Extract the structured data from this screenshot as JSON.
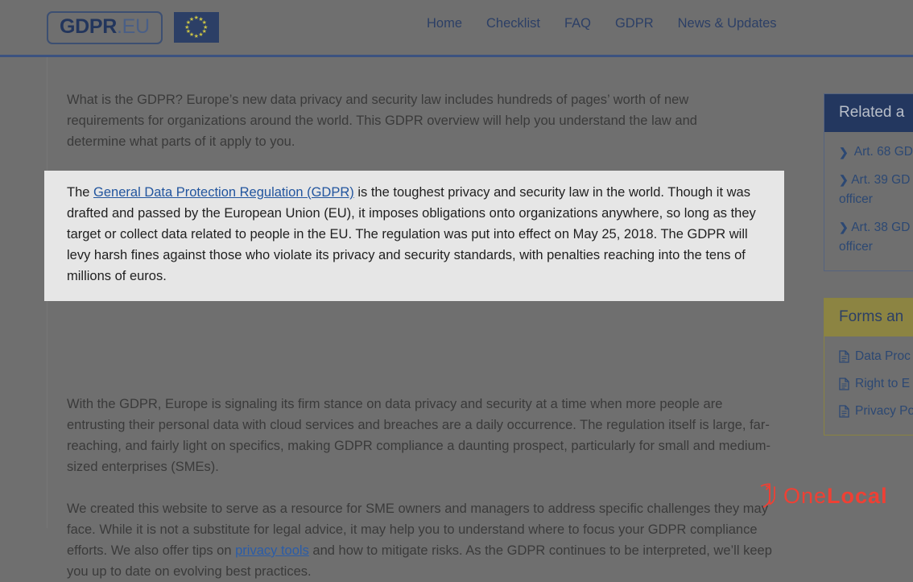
{
  "header": {
    "logo": {
      "primary": "GDPR",
      "secondary": ".EU"
    },
    "flag_alt": "eu-flag",
    "nav": [
      {
        "label": "Home"
      },
      {
        "label": "Checklist"
      },
      {
        "label": "FAQ"
      },
      {
        "label": "GDPR"
      },
      {
        "label": "News & Updates"
      }
    ]
  },
  "article": {
    "intro": "What is the GDPR? Europe’s new data privacy and security law includes hundreds of pages’ worth of new requirements for organizations around the world. This GDPR overview will help you understand the law and determine what parts of it apply to you.",
    "highlight": {
      "lead": "The ",
      "link": "General Data Protection Regulation (GDPR)",
      "rest": " is the toughest privacy and security law in the world. Though it was drafted and passed by the European Union (EU), it imposes obligations onto organizations anywhere, so long as they target or collect data related to people in the EU. The regulation was put into effect on May 25, 2018. The GDPR will levy harsh fines against those who violate its privacy and security standards, with penalties reaching into the tens of millions of euros."
    },
    "para2": "With the GDPR, Europe is signaling its firm stance on data privacy and security at a time when more people are entrusting their personal data with cloud services and breaches are a daily occurrence. The regulation itself is large, far-reaching, and fairly light on specifics, making GDPR compliance a daunting prospect, particularly for small and medium-sized enterprises (SMEs).",
    "para3": {
      "before": "We created this website to serve as a resource for SME owners and managers to address specific challenges they may face. While it is not a substitute for legal advice, it may help you to understand where to focus your GDPR compliance efforts. We also offer tips on ",
      "link": "privacy tools",
      "after": " and how to mitigate risks. As the GDPR continues to be interpreted, we’ll keep you up to date on evolving best practices."
    }
  },
  "sidebar": {
    "related": {
      "title": "Related a",
      "items": [
        {
          "icon": "chevron-right-icon",
          "label": "Art. 68 GD"
        },
        {
          "icon": "chevron-right-icon",
          "label": "Art. 39 GD",
          "label2": "officer"
        },
        {
          "icon": "chevron-right-icon",
          "label": "Art. 38 GD",
          "label2": "officer"
        }
      ]
    },
    "forms": {
      "title": "Forms an",
      "items": [
        {
          "icon": "document-icon",
          "label": "Data Proc"
        },
        {
          "icon": "document-icon",
          "label": "Right to E"
        },
        {
          "icon": "document-icon",
          "label": "Privacy Po"
        }
      ]
    }
  },
  "watermark": {
    "one": "One",
    "local": "Local"
  },
  "colors": {
    "page_bg": "#6f6f6f",
    "nav_blue": "#2c3f66",
    "rule_blue": "#3b5280",
    "card_navy": "#23375f",
    "card_olive": "#8c8442",
    "link_blue": "#22559e",
    "highlight_bg": "#e6e6e6",
    "watermark_red": "#ef4034"
  }
}
